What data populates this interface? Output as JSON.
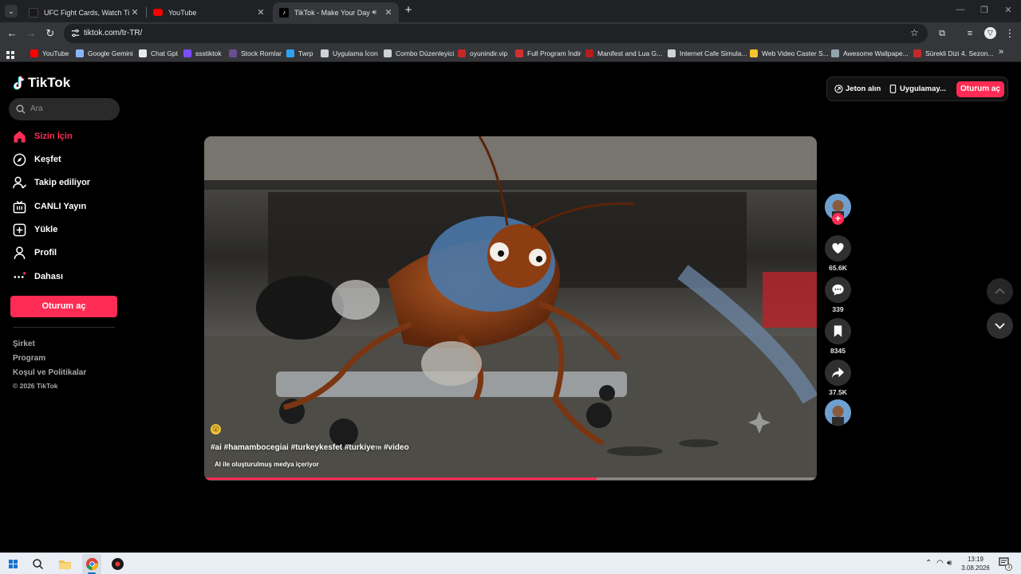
{
  "browser": {
    "tabs": [
      {
        "title": "UFC Fight Cards, Watch Times, L",
        "favicon_color": "#1a1a1a"
      },
      {
        "title": "YouTube",
        "favicon_color": "#ff0000"
      },
      {
        "title": "TikTok - Make Your Day",
        "favicon_color": "#000000"
      }
    ],
    "new_tab": "+",
    "url": "tiktok.com/tr-TR/",
    "bookmarks": [
      {
        "label": "YouTube",
        "color": "#ff0000"
      },
      {
        "label": "Google Gemini",
        "color": "#8ab4f8"
      },
      {
        "label": "Chat Gpt",
        "color": "#e8eaed"
      },
      {
        "label": "ssstiktok",
        "color": "#7c4dff"
      },
      {
        "label": "Stock Romlar",
        "color": "#6a4c93"
      },
      {
        "label": "Twrp",
        "color": "#2ea3f2"
      },
      {
        "label": "Uygulama İcon",
        "color": "#cfd3d8"
      },
      {
        "label": "Combo Düzenleyici",
        "color": "#cfd3d8"
      },
      {
        "label": "oyunindir.vip",
        "color": "#c62828"
      },
      {
        "label": "Full Program İndir",
        "color": "#d32f2f"
      },
      {
        "label": "Manifest and Lua G...",
        "color": "#b71c1c"
      },
      {
        "label": "Internet Cafe Simula...",
        "color": "#cfd3d8"
      },
      {
        "label": "Web Video Caster S...",
        "color": "#fbc02d"
      },
      {
        "label": "Awesome Wallpape...",
        "color": "#90a4ae"
      },
      {
        "label": "Sürekli Dizi 4. Sezon...",
        "color": "#c62828"
      }
    ],
    "more_bookmarks": "»"
  },
  "tiktok": {
    "logo_text": "TikTok",
    "search_placeholder": "Ara",
    "nav": [
      {
        "label": "Sizin İçin",
        "icon": "home-icon",
        "active": true
      },
      {
        "label": "Keşfet",
        "icon": "compass-icon",
        "active": false
      },
      {
        "label": "Takip ediliyor",
        "icon": "following-icon",
        "active": false
      },
      {
        "label": "CANLI Yayın",
        "icon": "live-icon",
        "active": false
      },
      {
        "label": "Yükle",
        "icon": "upload-icon",
        "active": false
      },
      {
        "label": "Profil",
        "icon": "profile-icon",
        "active": false
      },
      {
        "label": "Dahası",
        "icon": "more-icon",
        "active": false
      }
    ],
    "sidebar_login": "Oturum aç",
    "footer": [
      "Şirket",
      "Program",
      "Koşul ve Politikalar",
      "© 2026 TikTok"
    ],
    "top_right": {
      "coins": "Jeton alın",
      "app": "Uygulamay...",
      "login": "Oturum aç"
    },
    "video": {
      "caption": "#ai #hamambocegiai #turkeykesfet #turkiye",
      "caption_tr_tag": "TR",
      "caption_end": " #video",
      "ai_label": "AI ile oluşturulmuş medya içeriyor",
      "progress": 0.64
    },
    "actions": {
      "likes": "65.6K",
      "comments": "339",
      "saves": "8345",
      "shares": "37.5K"
    },
    "accent": "#fe2c55"
  },
  "taskbar": {
    "time": "13:19",
    "date": "3.08.2026",
    "notifications": "3"
  }
}
